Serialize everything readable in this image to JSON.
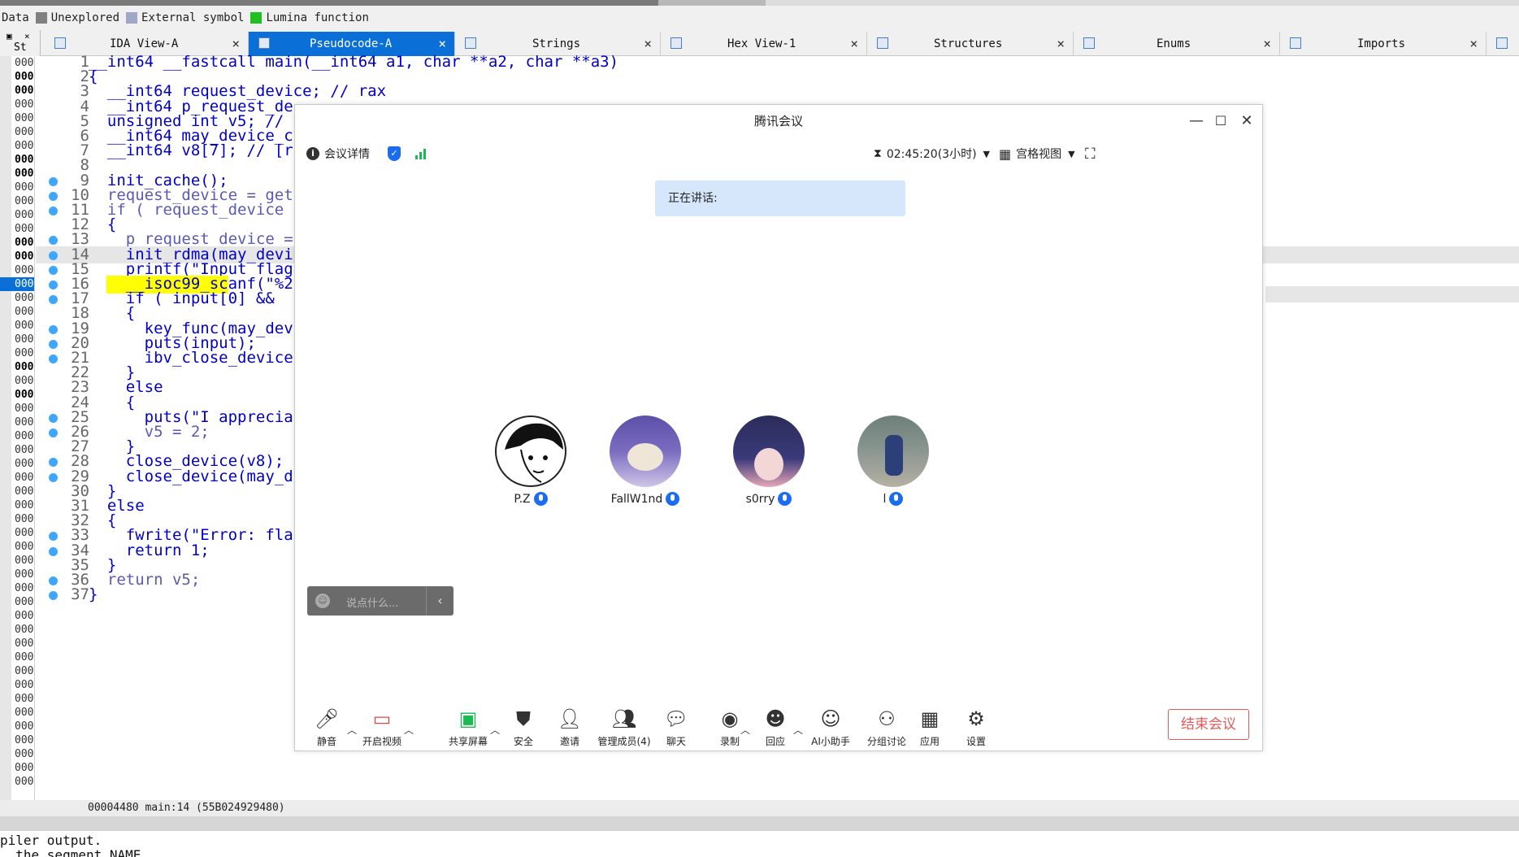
{
  "legend": {
    "items": [
      {
        "label": "Data",
        "color": ""
      },
      {
        "label": "Unexplored",
        "color": "#808080"
      },
      {
        "label": "External symbol",
        "color": "#a0a8c8"
      },
      {
        "label": "Lumina function",
        "color": "#20c020"
      }
    ]
  },
  "tabs": [
    {
      "label": "IDA View-A",
      "close": "×"
    },
    {
      "label": "Pseudocode-A",
      "close": "×"
    },
    {
      "label": "Strings",
      "close": "×"
    },
    {
      "label": "Hex View-1",
      "close": "×"
    },
    {
      "label": "Structures",
      "close": "×"
    },
    {
      "label": "Enums",
      "close": "×"
    },
    {
      "label": "Imports",
      "close": "×"
    }
  ],
  "left_header": "St",
  "left_rows": [
    "000",
    "000",
    "000",
    "000",
    "000",
    "000",
    "000",
    "000",
    "000",
    "000",
    "000",
    "000",
    "000",
    "000",
    "000",
    "000",
    "000",
    "000",
    "000",
    "000",
    "000",
    "000",
    "000",
    "000",
    "000",
    "000",
    "000",
    "000",
    "000",
    "000",
    "000",
    "000",
    "000",
    "000",
    "000",
    "000",
    "000",
    "000",
    "000",
    "000",
    "000",
    "000",
    "000",
    "000",
    "000",
    "000",
    "000",
    "000",
    "000",
    "000",
    "000",
    "000",
    "000"
  ],
  "code_lines": [
    {
      "n": "1",
      "t": "__int64 __fastcall main(__int64 a1, char **a2, char **a3)"
    },
    {
      "n": "2",
      "t": "{"
    },
    {
      "n": "3",
      "t": "  __int64 request_device; // rax"
    },
    {
      "n": "4",
      "t": "  __int64 p_request_de"
    },
    {
      "n": "5",
      "t": "  unsigned int v5; //"
    },
    {
      "n": "6",
      "t": "  __int64 may_device_c"
    },
    {
      "n": "7",
      "t": "  __int64 v8[7]; // [r"
    },
    {
      "n": "8",
      "t": ""
    },
    {
      "n": "9",
      "t": "  init_cache();"
    },
    {
      "n": "10",
      "t": "  request_device = get"
    },
    {
      "n": "11",
      "t": "  if ( request_device"
    },
    {
      "n": "12",
      "t": "  {"
    },
    {
      "n": "13",
      "t": "    p_request_device ="
    },
    {
      "n": "14",
      "t": "    init_rdma(may_devi"
    },
    {
      "n": "15",
      "t": "    printf(\"Input flag"
    },
    {
      "n": "16",
      "t": "    __isoc99_scanf(\"%2"
    },
    {
      "n": "17",
      "t": "    if ( input[0] &&"
    },
    {
      "n": "18",
      "t": "    {"
    },
    {
      "n": "19",
      "t": "      key_func(may_dev"
    },
    {
      "n": "20",
      "t": "      puts(input);"
    },
    {
      "n": "21",
      "t": "      ibv_close_device"
    },
    {
      "n": "22",
      "t": "    }"
    },
    {
      "n": "23",
      "t": "    else"
    },
    {
      "n": "24",
      "t": "    {"
    },
    {
      "n": "25",
      "t": "      puts(\"I apprecia"
    },
    {
      "n": "26",
      "t": "      v5 = 2;"
    },
    {
      "n": "27",
      "t": "    }"
    },
    {
      "n": "28",
      "t": "    close_device(v8);"
    },
    {
      "n": "29",
      "t": "    close_device(may_d"
    },
    {
      "n": "30",
      "t": "  }"
    },
    {
      "n": "31",
      "t": "  else"
    },
    {
      "n": "32",
      "t": "  {"
    },
    {
      "n": "33",
      "t": "    fwrite(\"Error: fla"
    },
    {
      "n": "34",
      "t": "    return 1;"
    },
    {
      "n": "35",
      "t": "  }"
    },
    {
      "n": "36",
      "t": "  return v5;"
    },
    {
      "n": "37",
      "t": "}"
    }
  ],
  "status": "00004480 main:14 (55B024929480)",
  "output": [
    "piler output.",
    "  the segment NAME"
  ],
  "meeting": {
    "title": "腾讯会议",
    "details": "会议详情",
    "timer": "02:45:20(3小时)",
    "view": "宫格视图",
    "speaking": "正在讲话:",
    "chat_placeholder": "说点什么...",
    "participants": [
      {
        "name": "P.Z"
      },
      {
        "name": "FallW1nd"
      },
      {
        "name": "s0rry"
      },
      {
        "name": "l"
      }
    ],
    "toolbar": [
      {
        "label": "静音",
        "icon": "mic-icon"
      },
      {
        "label": "开启视频",
        "icon": "camera-off-icon"
      },
      {
        "label": "共享屏幕",
        "icon": "share-screen-icon"
      },
      {
        "label": "安全",
        "icon": "shield-icon"
      },
      {
        "label": "邀请",
        "icon": "invite-icon"
      },
      {
        "label": "管理成员(4)",
        "icon": "members-icon"
      },
      {
        "label": "聊天",
        "icon": "chat-icon"
      },
      {
        "label": "录制",
        "icon": "record-icon"
      },
      {
        "label": "回应",
        "icon": "reaction-icon"
      },
      {
        "label": "AI小助手",
        "icon": "ai-assistant-icon"
      },
      {
        "label": "分组讨论",
        "icon": "breakout-icon"
      },
      {
        "label": "应用",
        "icon": "apps-icon"
      },
      {
        "label": "设置",
        "icon": "settings-icon"
      }
    ],
    "end_button": "结束会议"
  },
  "colors": {
    "accent": "#0a6fd6",
    "lumina": "#20c020",
    "code": "#0000c8",
    "end": "#e45a5a",
    "meeting_blue": "#1a6cf0"
  }
}
